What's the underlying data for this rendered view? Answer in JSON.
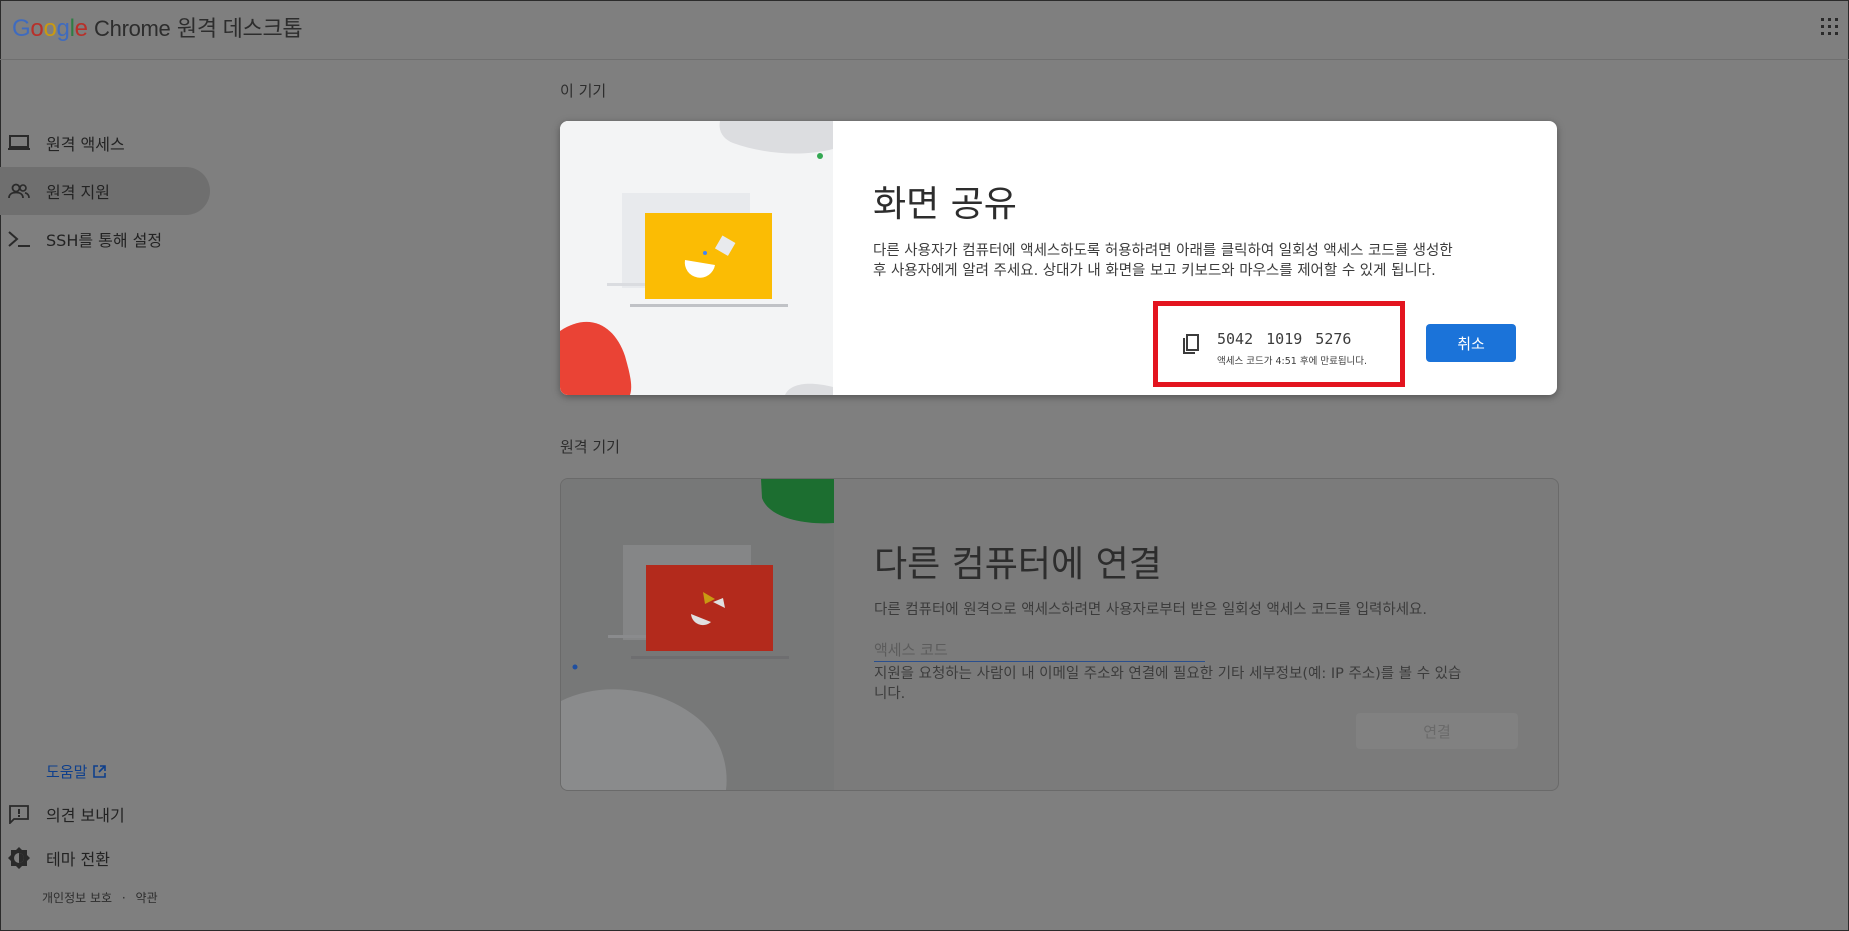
{
  "header": {
    "logo_letters": [
      "G",
      "o",
      "o",
      "g",
      "l",
      "e"
    ],
    "product": "Chrome",
    "app_title": "원격 데스크톱",
    "apps_icon": "apps-grid-icon"
  },
  "sidebar": {
    "items": [
      {
        "label": "원격 액세스",
        "icon": "laptop-icon"
      },
      {
        "label": "원격 지원",
        "icon": "people-icon"
      },
      {
        "label": "SSH를 통해 설정",
        "icon": "terminal-icon"
      }
    ],
    "help": "도움말",
    "feedback": "의견 보내기",
    "theme": "테마 전환",
    "privacy": "개인정보 보호",
    "separator": "·",
    "terms": "약관"
  },
  "this_device": {
    "section_title": "이 기기",
    "title": "화면 공유",
    "description_line1": "다른 사용자가 컴퓨터에 액세스하도록 허용하려면 아래를 클릭하여 일회성 액세스 코드를 생성한",
    "description_line2": "후 사용자에게 알려 주세요. 상대가 내 화면을 보고 키보드와 마우스를 제어할 수 있게 됩니다.",
    "access_code": "5042 1019 5276",
    "expiry_text": "액세스 코드가 4:51 후에 만료됩니다.",
    "cancel_label": "취소"
  },
  "remote_device": {
    "section_title": "원격 기기",
    "title": "다른 컴퓨터에 연결",
    "description": "다른 컴퓨터에 원격으로 액세스하려면 사용자로부터 받은 일회성 액세스 코드를 입력하세요.",
    "code_placeholder": "액세스 코드",
    "notice_line1": "지원을 요청하는 사람이 내 이메일 주소와 연결에 필요한 기타 세부정보(예: IP 주소)를 볼 수 있습",
    "notice_line2": "니다.",
    "connect_label": "연결"
  },
  "colors": {
    "overlay_bg": "#7f7f7f",
    "primary": "#1b73d9",
    "highlight": "#e3141f",
    "yellow_laptop": "#fbbc04",
    "red_laptop": "#b32a1c"
  }
}
